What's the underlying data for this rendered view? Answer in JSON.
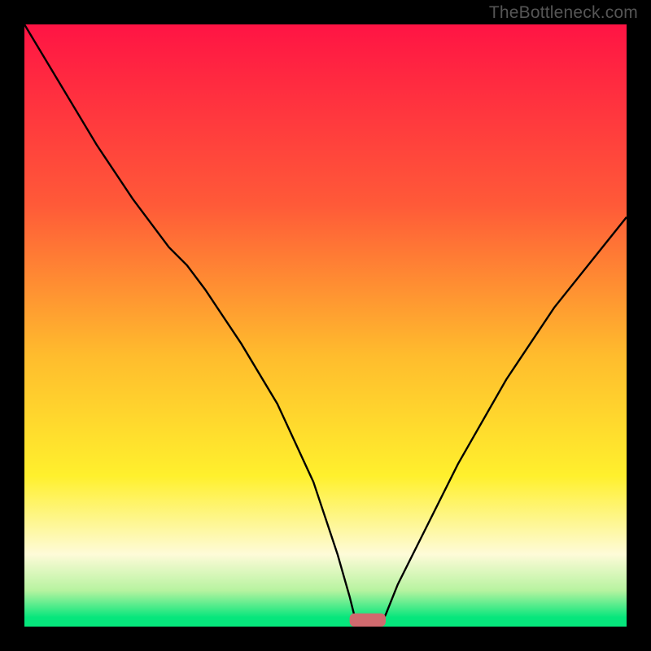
{
  "watermark": "TheBottleneck.com",
  "colors": {
    "gradient_top": "#ff1444",
    "gradient_mid1": "#ff8a2c",
    "gradient_mid2": "#ffea2d",
    "gradient_pale": "#fefbd8",
    "gradient_green": "#06e67c",
    "curve": "#000000",
    "marker": "#d06a6e",
    "frame": "#000000"
  },
  "chart_data": {
    "type": "line",
    "title": "",
    "xlabel": "",
    "ylabel": "",
    "xlim": [
      0,
      100
    ],
    "ylim": [
      0,
      100
    ],
    "grid": false,
    "legend": false,
    "series": [
      {
        "name": "bottleneck-curve",
        "x": [
          0,
          6,
          12,
          18,
          24,
          27,
          30,
          36,
          42,
          48,
          50,
          52,
          54,
          55,
          57,
          59,
          60,
          62,
          66,
          72,
          80,
          88,
          96,
          100
        ],
        "values": [
          100,
          90,
          80,
          71,
          63,
          60,
          56,
          47,
          37,
          24,
          18,
          12,
          5,
          1,
          0,
          0,
          2,
          7,
          15,
          27,
          41,
          53,
          63,
          68
        ]
      }
    ],
    "marker": {
      "x_center": 57,
      "width": 6,
      "height": 2.2,
      "y": 0
    },
    "gradient_stops": [
      {
        "offset": 0.0,
        "color": "#ff1444"
      },
      {
        "offset": 0.3,
        "color": "#ff5a38"
      },
      {
        "offset": 0.55,
        "color": "#ffbc2d"
      },
      {
        "offset": 0.75,
        "color": "#fff02d"
      },
      {
        "offset": 0.88,
        "color": "#fefbd8"
      },
      {
        "offset": 0.94,
        "color": "#b7f3a0"
      },
      {
        "offset": 0.985,
        "color": "#06e67c"
      },
      {
        "offset": 1.0,
        "color": "#06e67c"
      }
    ]
  }
}
